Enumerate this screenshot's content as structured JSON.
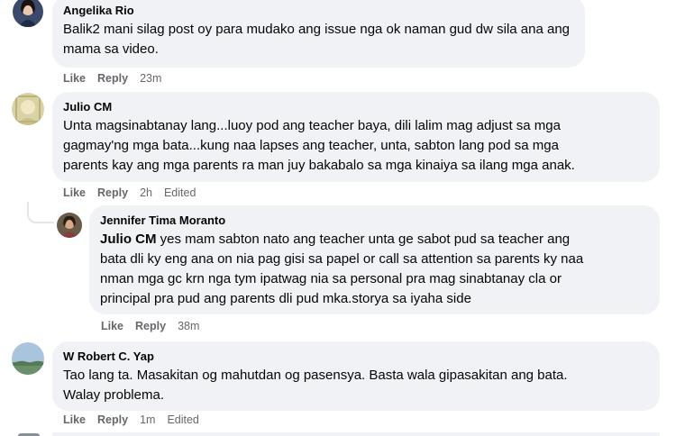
{
  "comments": [
    {
      "name": "Angelika Rio",
      "text": "Balik2 mani silag post oy para mudako ang issue nga ok naman gud dw sila ana ang\nmama sa video.",
      "like": "Like",
      "reply": "Reply",
      "time": "23m",
      "edited": ""
    },
    {
      "name": "Julio CM",
      "text": "Unta magsinabtanay lang...luoy pod ang teacher baya, dili lalim mag adjust sa mga\ngagmay'ng mga bata...kung naa lapses ang teacher, unta, sabton lang pod sa mga\nparents kay ang mga parents ra man juy bakabalo sa mga kinaiya sa ilang mga anak.",
      "like": "Like",
      "reply": "Reply",
      "time": "2h",
      "edited": "Edited"
    },
    {
      "name": "Jennifer Tima Moranto",
      "mention": "Julio CM",
      "text": " yes mam sabton nato ang teacher unta ge sabot pud sa teacher ang\nbata dli ky eng ana on nia pag gisi sa papel or call sa attention sa parents ky naa\nnman mga gc krn nga tym ipatwag nia sa personal pra mag sinabtanay cla or\nprincipal pra pud ang parents dli pud mka.storya sa iyaha side",
      "like": "Like",
      "reply": "Reply",
      "time": "38m",
      "edited": ""
    },
    {
      "name": "W Robert C. Yap",
      "text": "Tao lang ta. Masakitan og mahutdan og pasensya. Basta wala gipasakitan ang bata.\nWalay problema.",
      "like": "Like",
      "reply": "Reply",
      "time": "1m",
      "edited": "Edited"
    }
  ],
  "colors": {
    "bubble": "#f0f2f5",
    "meta_text": "#65676b",
    "text": "#050505"
  }
}
